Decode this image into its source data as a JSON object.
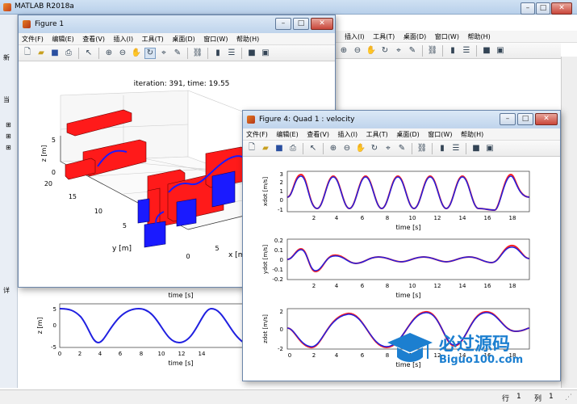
{
  "main_window": {
    "title": "MATLAB R2018a",
    "menus": [
      "插入(I)",
      "工具(T)",
      "桌面(D)",
      "窗口(W)",
      "帮助(H)"
    ],
    "left_labels": [
      "新",
      "当",
      "详"
    ],
    "status_row_label": "行",
    "status_row_value": "1",
    "status_col_label": "列",
    "status_col_value": "1"
  },
  "figure1": {
    "title": "Figure 1",
    "menus": [
      "文件(F)",
      "编辑(E)",
      "查看(V)",
      "插入(I)",
      "工具(T)",
      "桌面(D)",
      "窗口(W)",
      "帮助(H)"
    ],
    "plot_title": "iteration: 391, time: 19.55",
    "zlabel": "z [m]",
    "ylabel": "y [m]",
    "xlabel": "x [m]",
    "z_ticks": [
      "5",
      "0"
    ],
    "y_ticks": [
      "20",
      "15",
      "10",
      "5",
      "0"
    ],
    "x_ticks": [
      "0",
      "5"
    ]
  },
  "behind_plot": {
    "top_xlabel": "time [s]",
    "ylabel": "z [m]",
    "xlabel": "time [s]",
    "y_ticks": [
      "5",
      "0",
      "-5"
    ],
    "x_ticks": [
      "0",
      "2",
      "4",
      "6",
      "8",
      "10",
      "12",
      "14"
    ]
  },
  "figure4": {
    "title": "Figure 4: Quad 1 : velocity",
    "menus": [
      "文件(F)",
      "编辑(E)",
      "查看(V)",
      "插入(I)",
      "工具(T)",
      "桌面(D)",
      "窗口(W)",
      "帮助(H)"
    ],
    "subplots": [
      {
        "ylabel": "xdot [m/s]",
        "xlabel": "time [s]",
        "y_ticks": [
          "3",
          "2",
          "1",
          "0",
          "-1"
        ]
      },
      {
        "ylabel": "ydot [m/s]",
        "xlabel": "time [s]",
        "y_ticks": [
          "0.2",
          "0.1",
          "0",
          "-0.1",
          "-0.2"
        ]
      },
      {
        "ylabel": "zdot [m/s]",
        "xlabel": "time [s]",
        "y_ticks": [
          "2",
          "0",
          "-2"
        ]
      }
    ],
    "x_ticks": [
      "0",
      "2",
      "4",
      "6",
      "8",
      "10",
      "12",
      "14",
      "16",
      "18"
    ]
  },
  "watermark": {
    "cn": "必过源码",
    "en": "Biguo100.com"
  },
  "colors": {
    "quad_red": "#ff1a1a",
    "quad_blue": "#1a1aff",
    "trace_blue": "#2020e0",
    "trace_red": "#ff2020"
  }
}
